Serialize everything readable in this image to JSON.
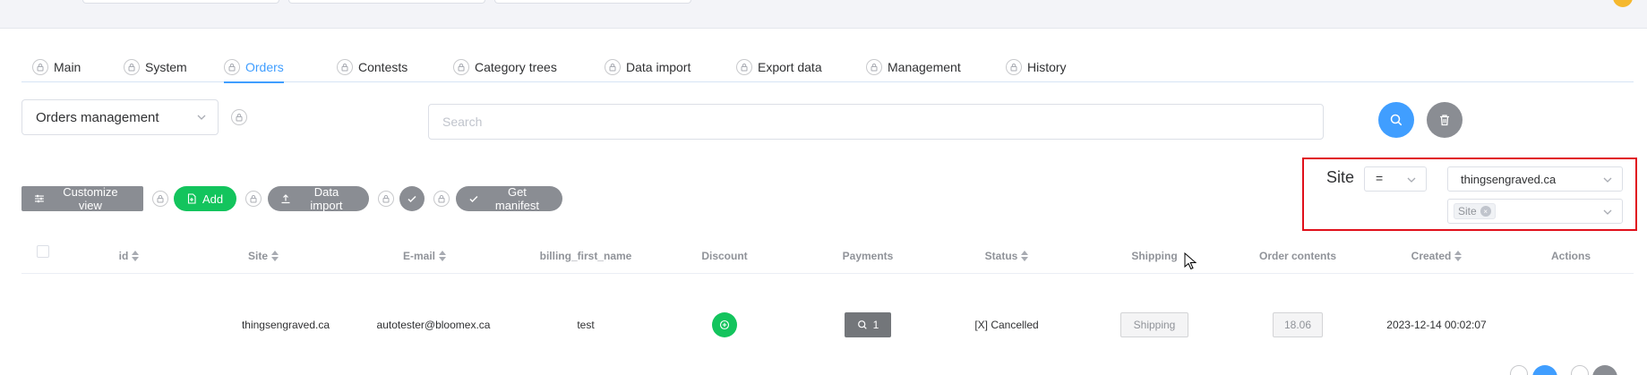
{
  "tabs": [
    {
      "label": "Main"
    },
    {
      "label": "System"
    },
    {
      "label": "Orders"
    },
    {
      "label": "Contests"
    },
    {
      "label": "Category trees"
    },
    {
      "label": "Data import"
    },
    {
      "label": "Export data"
    },
    {
      "label": "Management"
    },
    {
      "label": "History"
    }
  ],
  "active_tab": "Orders",
  "module_select": {
    "value": "Orders management"
  },
  "search": {
    "placeholder": "Search"
  },
  "toolbar": {
    "customize_view_label": "Customize view",
    "add_label": "Add",
    "data_import_label": "Data import",
    "get_manifest_label": "Get manifest"
  },
  "filter": {
    "field_label": "Site",
    "operator": "=",
    "value": "thingsengraved.ca",
    "tag_label": "Site"
  },
  "table": {
    "columns": [
      "id",
      "Site",
      "E-mail",
      "billing_first_name",
      "Discount",
      "Payments",
      "Status",
      "Shipping",
      "Order contents",
      "Created",
      "Actions"
    ],
    "rows": [
      {
        "id": "",
        "site": "thingsengraved.ca",
        "email": "autotester@bloomex.ca",
        "billing_first_name": "test",
        "payments": "1",
        "status": "[X] Cancelled",
        "shipping": "Shipping",
        "order_contents": "18.06",
        "created": "2023-12-14 00:02:07"
      }
    ]
  },
  "colors": {
    "accent": "#409eff",
    "success": "#13c45d",
    "highlight_border": "#e0101b",
    "neutral_button": "#8a8d93"
  }
}
